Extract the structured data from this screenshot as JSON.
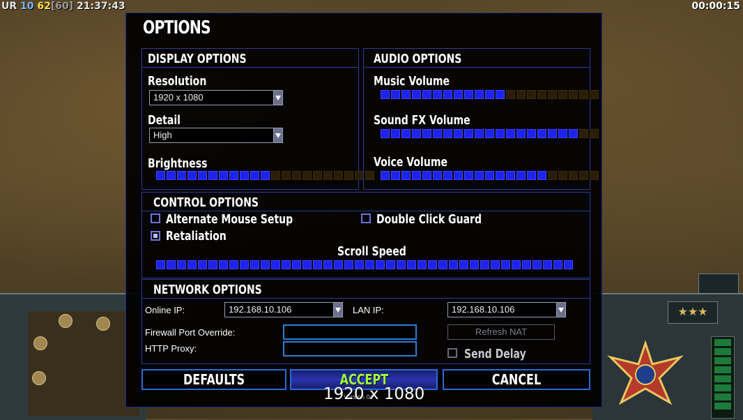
{
  "hud": {
    "left": {
      "faction": "UR",
      "num1": "10",
      "num2": "62",
      "bracket": "[60]",
      "clock": "21:37:43"
    },
    "right_timer": "00:00:15"
  },
  "dialog": {
    "title": "OPTIONS",
    "display": {
      "header": "DISPLAY OPTIONS",
      "resolution_label": "Resolution",
      "resolution_value": "1920 x 1080",
      "detail_label": "Detail",
      "detail_value": "High",
      "brightness_label": "Brightness",
      "brightness_level": {
        "filled": 11,
        "total": 21
      }
    },
    "audio": {
      "header": "AUDIO OPTIONS",
      "music_label": "Music Volume",
      "music_level": {
        "filled": 12,
        "total": 21
      },
      "sfx_label": "Sound FX Volume",
      "sfx_level": {
        "filled": 19,
        "total": 21
      },
      "voice_label": "Voice Volume",
      "voice_level": {
        "filled": 16,
        "total": 21
      }
    },
    "control": {
      "header": "CONTROL OPTIONS",
      "alt_mouse_label": "Alternate Mouse Setup",
      "alt_mouse_checked": false,
      "double_click_label": "Double Click Guard",
      "double_click_checked": false,
      "retaliation_label": "Retaliation",
      "retaliation_checked": true,
      "scroll_label": "Scroll Speed",
      "scroll_level": {
        "filled": 40,
        "total": 40
      }
    },
    "network": {
      "header": "NETWORK OPTIONS",
      "online_ip_label": "Online IP:",
      "online_ip_value": "192.168.10.106",
      "lan_ip_label": "LAN IP:",
      "lan_ip_value": "192.168.10.106",
      "firewall_label": "Firewall Port Override:",
      "firewall_value": "",
      "http_label": "HTTP Proxy:",
      "http_value": "",
      "refresh_label": "Refresh NAT",
      "send_delay_label": "Send Delay",
      "send_delay_checked": false
    },
    "buttons": {
      "defaults": "DEFAULTS",
      "accept": "ACCEPT",
      "cancel": "CANCEL"
    },
    "version": "Version 04",
    "tooltip": "1920 x 1080"
  },
  "side": {
    "rank_stars": "★★★"
  },
  "colors": {
    "slider_on": "#1e22ee",
    "slider_off": "#2a1e08",
    "accept_text": "#9cff3c",
    "panel_border": "#2a3c9a"
  }
}
